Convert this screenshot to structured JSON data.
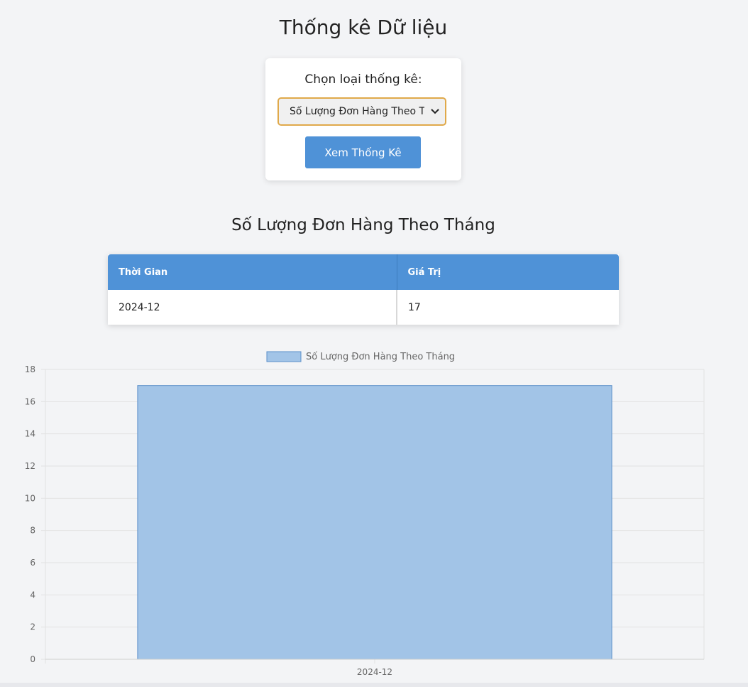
{
  "page": {
    "title": "Thống kê Dữ liệu"
  },
  "controls": {
    "label": "Chọn loại thống kê:",
    "selected_option": "Số Lượng Đơn Hàng Theo Tháng",
    "submit_label": "Xem Thống Kê",
    "accent_color": "#4f92d7",
    "select_border_color": "#e0a94a"
  },
  "result": {
    "title": "Số Lượng Đơn Hàng Theo Tháng",
    "table": {
      "headers": [
        "Thời Gian",
        "Giá Trị"
      ],
      "rows": [
        [
          "2024-12",
          "17"
        ]
      ]
    }
  },
  "chart_data": {
    "type": "bar",
    "categories": [
      "2024-12"
    ],
    "series": [
      {
        "name": "Số Lượng Đơn Hàng Theo Tháng",
        "values": [
          17
        ]
      }
    ],
    "ylim": [
      0,
      18
    ],
    "yticks": [
      0,
      2,
      4,
      6,
      8,
      10,
      12,
      14,
      16,
      18
    ],
    "grid": true,
    "legend": "top-center",
    "bar_fill": "#a2c4e7",
    "bar_stroke": "#5b8fc9"
  }
}
